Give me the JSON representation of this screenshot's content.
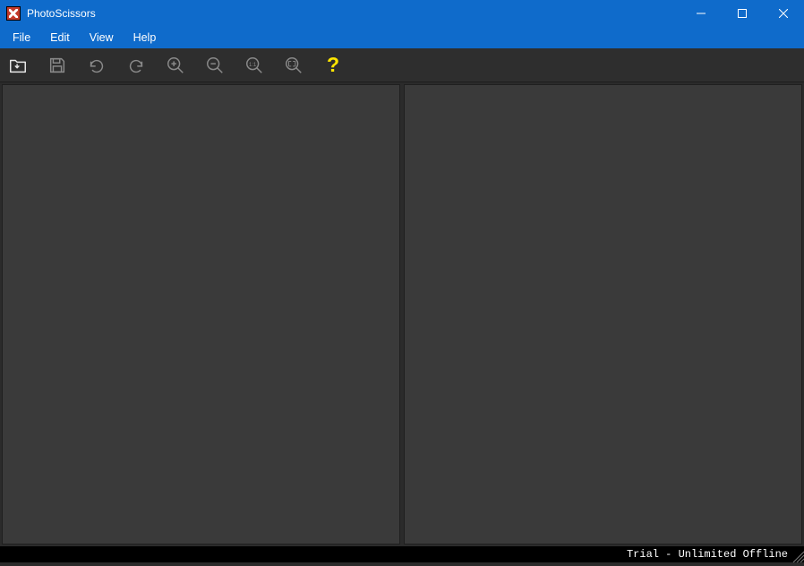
{
  "titlebar": {
    "title": "PhotoScissors"
  },
  "menubar": {
    "items": [
      {
        "label": "File"
      },
      {
        "label": "Edit"
      },
      {
        "label": "View"
      },
      {
        "label": "Help"
      }
    ]
  },
  "toolbar": {
    "open": "Open",
    "save": "Save",
    "undo": "Undo",
    "redo": "Redo",
    "zoom_in": "Zoom In",
    "zoom_out": "Zoom Out",
    "zoom_actual": "1:1",
    "zoom_fit": "Fit",
    "help": "?"
  },
  "statusbar": {
    "text": "Trial - Unlimited Offline"
  }
}
